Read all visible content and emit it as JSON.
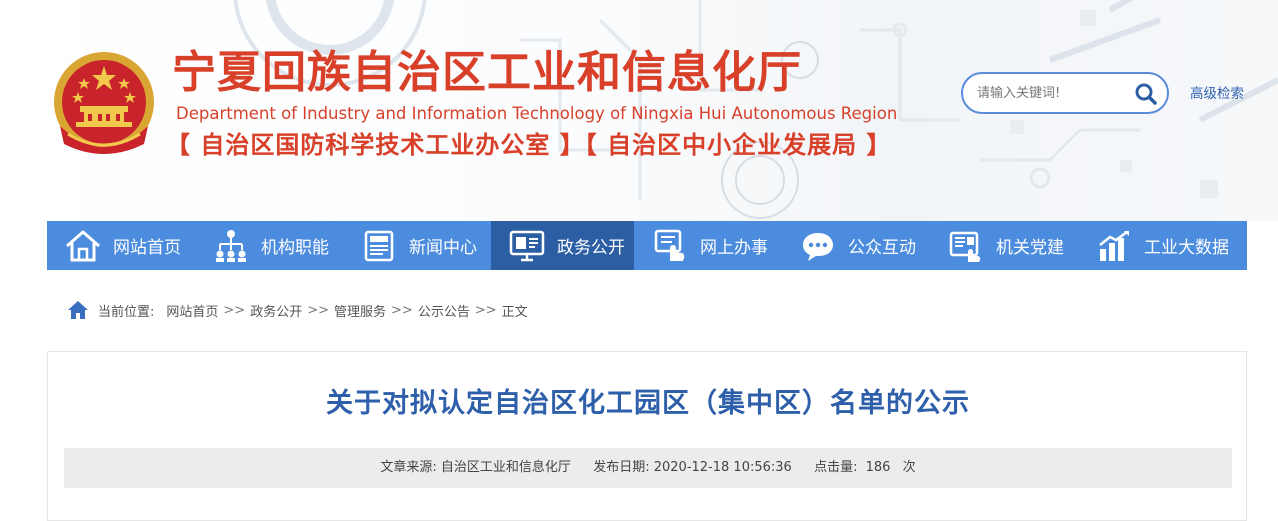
{
  "header": {
    "title": "宁夏回族自治区工业和信息化厅",
    "subtitle": "Department of Industry and Information Technology of Ningxia Hui Autonomous Region",
    "affiliations": "【 自治区国防科学技术工业办公室 】【 自治区中小企业发展局 】"
  },
  "search": {
    "placeholder": "请输入关键词!",
    "value": "",
    "advanced_label": "高级检索",
    "icon": "search-icon"
  },
  "nav": {
    "active_index": 3,
    "items": [
      {
        "label": "网站首页",
        "icon": "home-icon"
      },
      {
        "label": "机构职能",
        "icon": "org-chart-icon"
      },
      {
        "label": "新闻中心",
        "icon": "news-icon"
      },
      {
        "label": "政务公开",
        "icon": "monitor-icon"
      },
      {
        "label": "网上办事",
        "icon": "online-service-icon"
      },
      {
        "label": "公众互动",
        "icon": "chat-icon"
      },
      {
        "label": "机关党建",
        "icon": "party-building-icon"
      },
      {
        "label": "工业大数据",
        "icon": "bar-chart-icon"
      }
    ]
  },
  "breadcrumb": {
    "prefix": "当前位置:",
    "separator": ">>",
    "items": [
      "网站首页",
      "政务公开",
      "管理服务",
      "公示公告",
      "正文"
    ]
  },
  "article": {
    "title": "关于对拟认定自治区化工园区（集中区）名单的公示",
    "source_label": "文章来源:",
    "source": "自治区工业和信息化厅",
    "date_label": "发布日期:",
    "date": "2020-12-18 10:56:36",
    "clicks_label": "点击量:",
    "clicks": "186",
    "clicks_unit": "次"
  },
  "colors": {
    "brand_red": "#d8402a",
    "nav_blue": "#4c8cdf",
    "nav_active": "#2c5ea4",
    "title_blue": "#2e5faa"
  }
}
